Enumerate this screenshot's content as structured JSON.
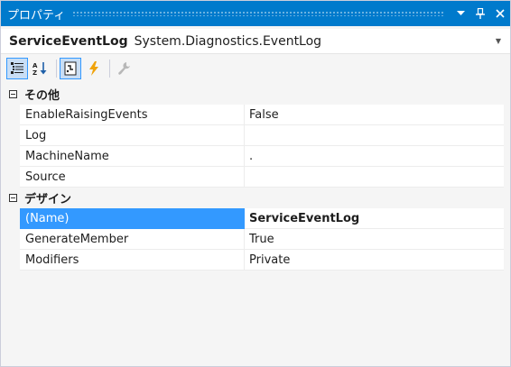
{
  "window": {
    "title": "プロパティ",
    "buttons": {
      "dropdown_icon": "chevron-down-icon",
      "pin_icon": "pin-icon",
      "close_icon": "close-icon"
    }
  },
  "object_selector": {
    "name": "ServiceEventLog",
    "type": "System.Diagnostics.EventLog"
  },
  "toolbar": {
    "buttons": [
      {
        "icon": "categorized-icon",
        "active": true
      },
      {
        "icon": "alphabetical-icon",
        "active": false
      },
      {
        "icon": "properties-icon",
        "active": true
      },
      {
        "icon": "events-icon",
        "active": false
      },
      {
        "icon": "property-pages-icon",
        "active": false
      }
    ]
  },
  "categories": [
    {
      "label": "その他",
      "properties": [
        {
          "name": "EnableRaisingEvents",
          "value": "False"
        },
        {
          "name": "Log",
          "value": ""
        },
        {
          "name": "MachineName",
          "value": "."
        },
        {
          "name": "Source",
          "value": ""
        }
      ]
    },
    {
      "label": "デザイン",
      "properties": [
        {
          "name": "(Name)",
          "value": "ServiceEventLog",
          "selected": true
        },
        {
          "name": "GenerateMember",
          "value": "True"
        },
        {
          "name": "Modifiers",
          "value": "Private"
        }
      ]
    }
  ],
  "colors": {
    "titlebar": "#007acc",
    "selection": "#3399ff",
    "events_icon": "#f0a30a"
  }
}
